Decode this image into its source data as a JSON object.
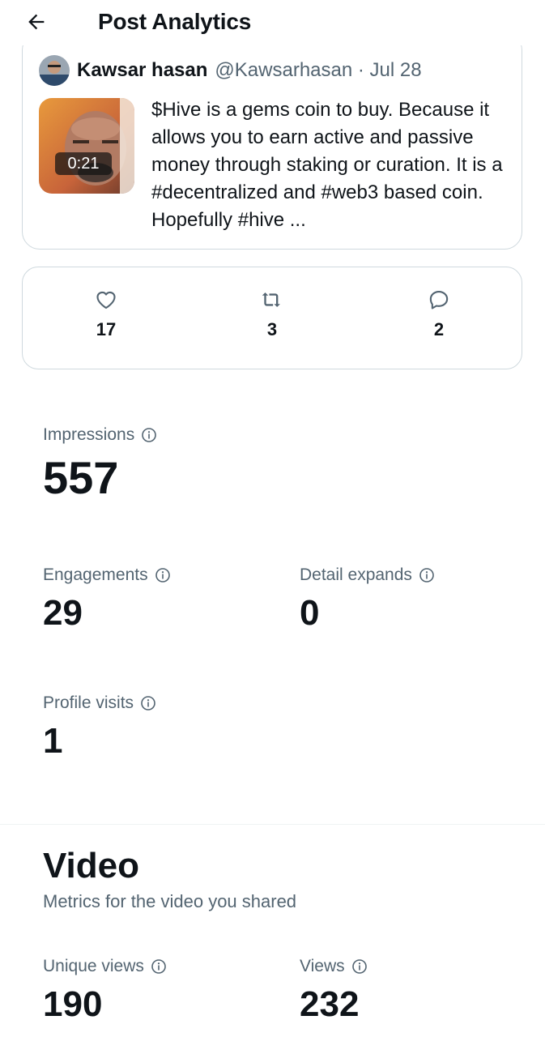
{
  "header": {
    "title": "Post Analytics"
  },
  "post": {
    "author_name": "Kawsar hasan",
    "handle_date": "@Kawsarhasan · Jul 28",
    "video_duration": "0:21",
    "text": "$Hive is a gems coin to buy. Because it allows you to earn active and passive money through staking or curation. It is a #decentralized and #web3 based coin. Hopefully #hive ..."
  },
  "engagement": {
    "likes": "17",
    "reposts": "3",
    "replies": "2"
  },
  "metrics": {
    "impressions": {
      "label": "Impressions",
      "value": "557"
    },
    "engagements": {
      "label": "Engagements",
      "value": "29"
    },
    "detail_expands": {
      "label": "Detail expands",
      "value": "0"
    },
    "profile_visits": {
      "label": "Profile visits",
      "value": "1"
    }
  },
  "video": {
    "title": "Video",
    "subtitle": "Metrics for the video you shared",
    "unique_views": {
      "label": "Unique views",
      "value": "190"
    },
    "views": {
      "label": "Views",
      "value": "232"
    }
  },
  "colors": {
    "text": "#0f1419",
    "secondary": "#536471",
    "border": "#cfd9de"
  },
  "icons": [
    "back-arrow-icon",
    "heart-icon",
    "repost-icon",
    "reply-icon",
    "info-icon"
  ]
}
